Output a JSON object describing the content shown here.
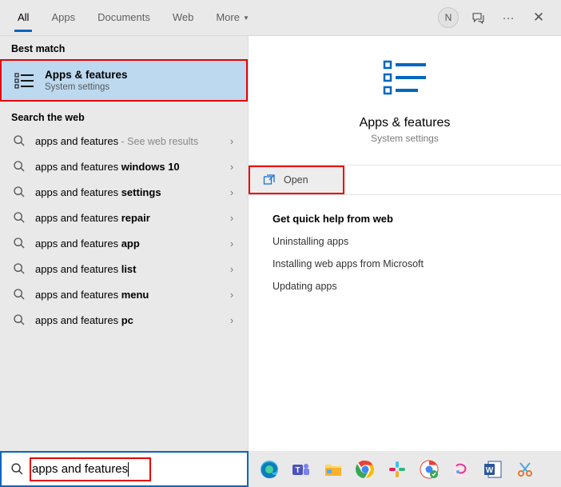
{
  "header": {
    "tabs": [
      "All",
      "Apps",
      "Documents",
      "Web",
      "More"
    ],
    "active_tab_index": 0,
    "more_has_dropdown": true,
    "avatar_letter": "N"
  },
  "left": {
    "best_match_label": "Best match",
    "best_match": {
      "title": "Apps & features",
      "subtitle": "System settings"
    },
    "web_label": "Search the web",
    "web_results": [
      {
        "prefix": "apps and features",
        "suffix": "",
        "note": " - See web results"
      },
      {
        "prefix": "apps and features ",
        "suffix": "windows 10",
        "note": ""
      },
      {
        "prefix": "apps and features ",
        "suffix": "settings",
        "note": ""
      },
      {
        "prefix": "apps and features ",
        "suffix": "repair",
        "note": ""
      },
      {
        "prefix": "apps and features ",
        "suffix": "app",
        "note": ""
      },
      {
        "prefix": "apps and features ",
        "suffix": "list",
        "note": ""
      },
      {
        "prefix": "apps and features ",
        "suffix": "menu",
        "note": ""
      },
      {
        "prefix": "apps and features ",
        "suffix": "pc",
        "note": ""
      }
    ]
  },
  "right": {
    "preview_title": "Apps & features",
    "preview_subtitle": "System settings",
    "open_label": "Open",
    "quick_help_title": "Get quick help from web",
    "quick_help_items": [
      "Uninstalling apps",
      "Installing web apps from Microsoft",
      "Updating apps"
    ]
  },
  "search": {
    "value": "apps and features"
  },
  "taskbar": {
    "icons": [
      "edge",
      "teams",
      "file-explorer",
      "chrome",
      "slack",
      "chrome-canary",
      "onenote",
      "word",
      "snipping"
    ]
  }
}
